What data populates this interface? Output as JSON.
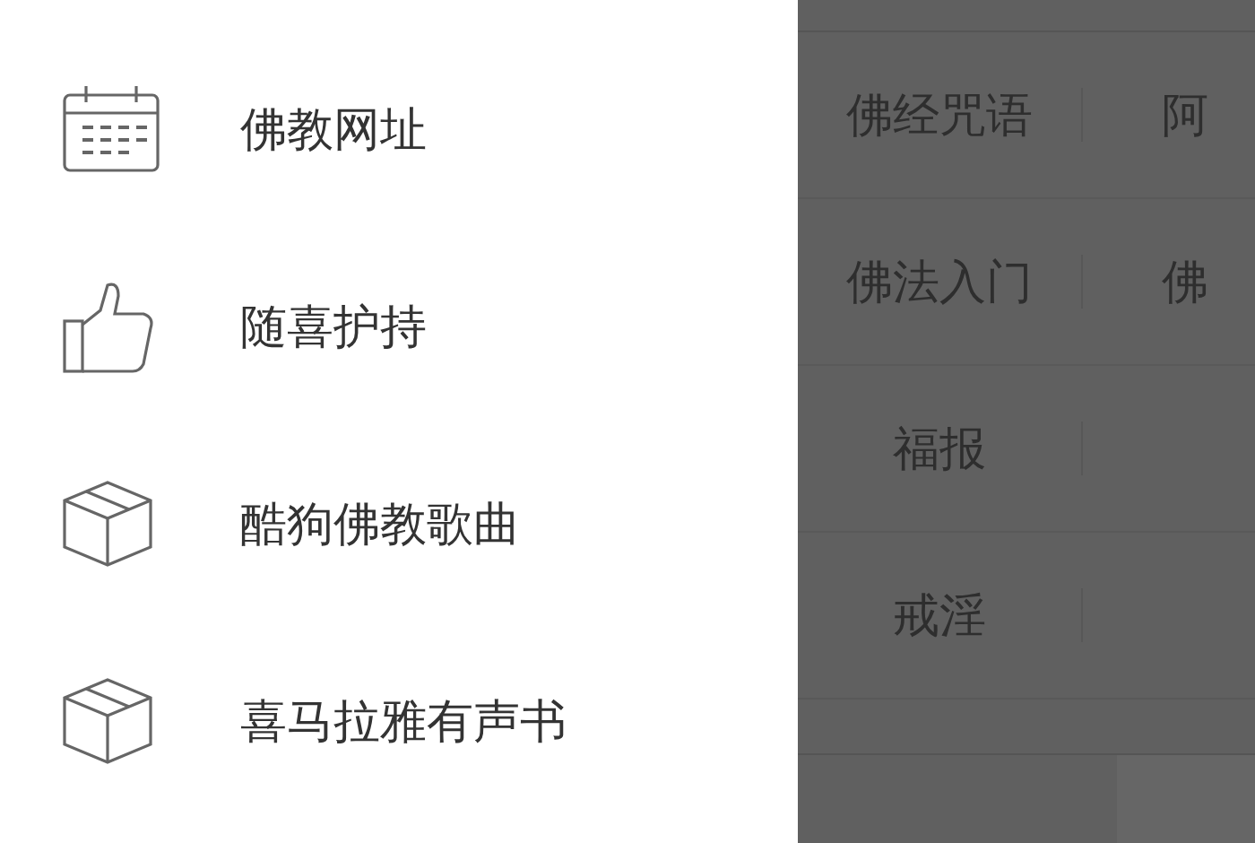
{
  "drawer": {
    "items": [
      {
        "kind": "calendar",
        "label": "佛教网址"
      },
      {
        "kind": "thumb",
        "label": "随喜护持"
      },
      {
        "kind": "box",
        "label": "酷狗佛教歌曲"
      },
      {
        "kind": "box",
        "label": "喜马拉雅有声书"
      }
    ]
  },
  "background_grid": {
    "rows": [
      {
        "column_1": "佛经咒语",
        "column_2": "阿"
      },
      {
        "column_1": "佛法入门",
        "column_2": "佛"
      },
      {
        "column_1": "福报"
      },
      {
        "column_1": "戒淫"
      }
    ]
  }
}
